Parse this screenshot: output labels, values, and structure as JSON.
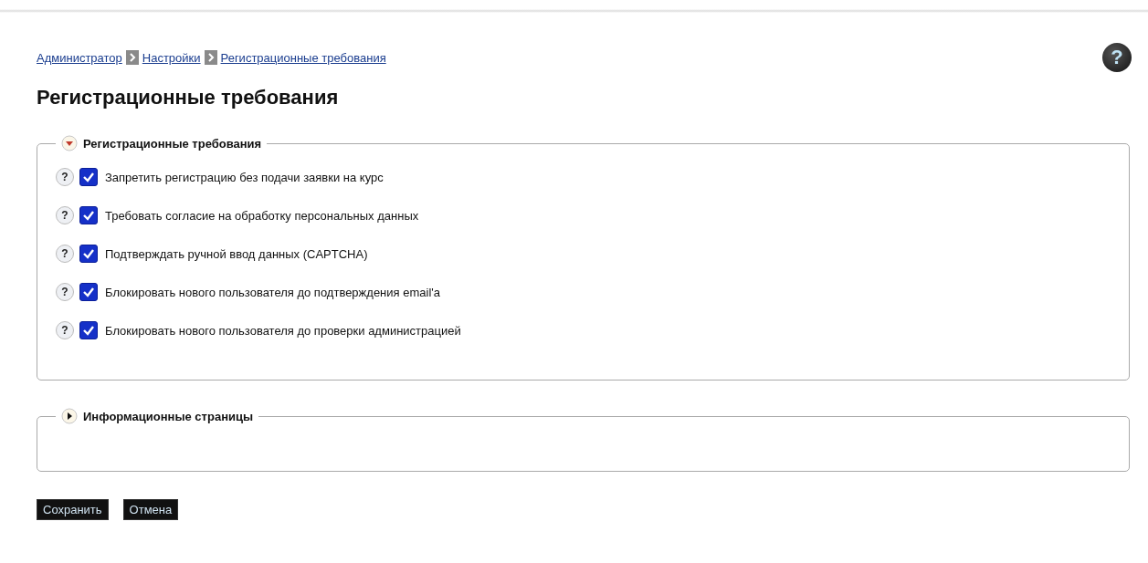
{
  "breadcrumbs": [
    {
      "label": "Администратор"
    },
    {
      "label": "Настройки"
    },
    {
      "label": "Регистрационные требования"
    }
  ],
  "help": "?",
  "title": "Регистрационные требования",
  "sections": [
    {
      "title": "Регистрационные требования",
      "expanded": true,
      "items": [
        {
          "help": "?",
          "label": "Запретить регистрацию без подачи заявки на курс",
          "checked": true
        },
        {
          "help": "?",
          "label": "Требовать согласие на обработку персональных данных",
          "checked": true
        },
        {
          "help": "?",
          "label": "Подтверждать ручной ввод данных (CAPTCHA)",
          "checked": true
        },
        {
          "help": "?",
          "label": "Блокировать нового пользователя до подтверждения email'a",
          "checked": true
        },
        {
          "help": "?",
          "label": "Блокировать нового пользователя до проверки администрацией",
          "checked": true
        }
      ]
    },
    {
      "title": "Информационные страницы",
      "expanded": false
    }
  ],
  "buttons": [
    "Сохранить",
    "Отмена"
  ]
}
